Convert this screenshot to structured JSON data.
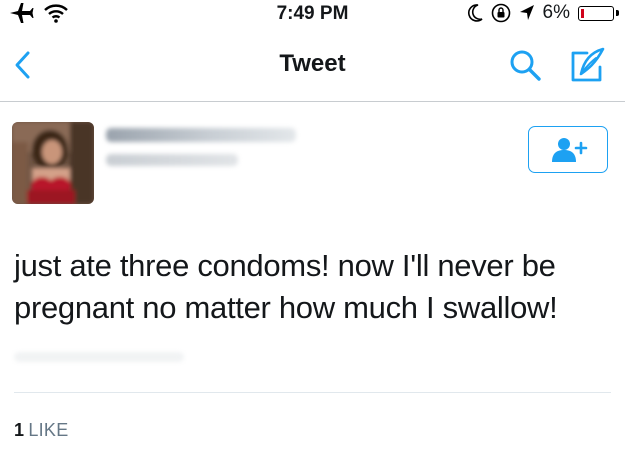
{
  "status_bar": {
    "time": "7:49 PM",
    "battery_percent": "6%",
    "battery_color": "#d0021b",
    "icons": [
      "airplane-icon",
      "wifi-icon",
      "moon-icon",
      "orientation-lock-icon",
      "location-icon",
      "battery-icon"
    ]
  },
  "nav": {
    "title": "Tweet",
    "accent_color": "#1da1f2",
    "icons": [
      "back-chevron-icon",
      "search-icon",
      "compose-icon"
    ]
  },
  "tweet": {
    "text": "just ate three condoms! now I'll never be pregnant no matter how much I swallow!",
    "like_count": "1",
    "like_label": "LIKE"
  }
}
